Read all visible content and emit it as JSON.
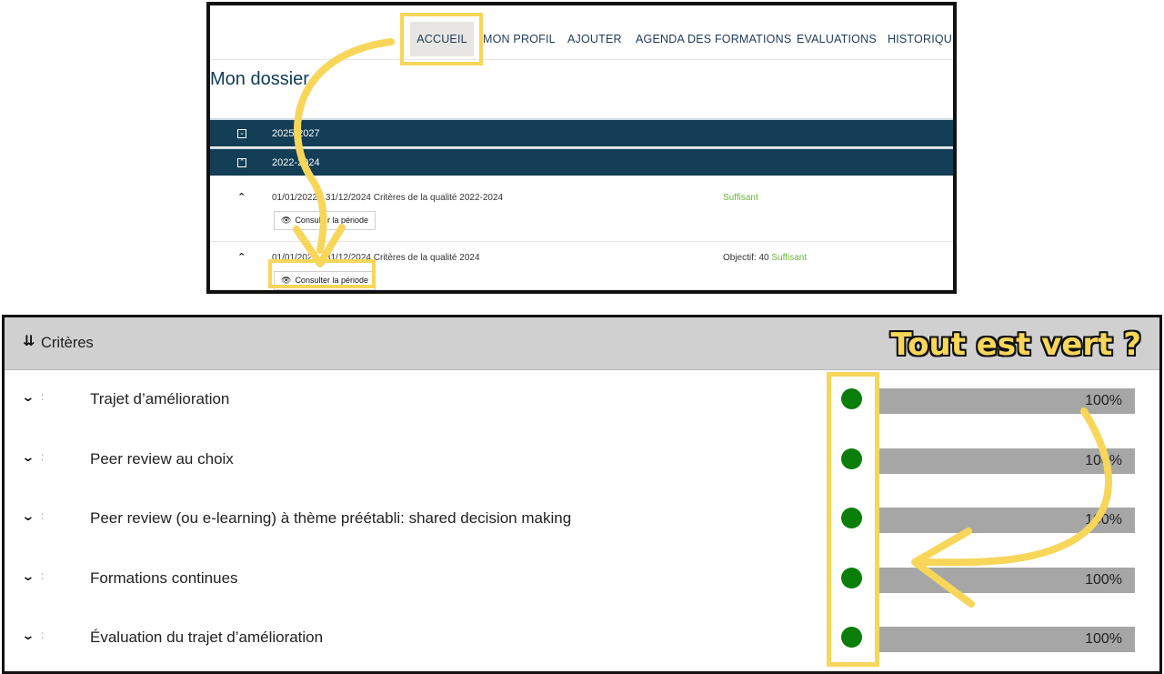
{
  "nav": {
    "items": [
      "ACCUEIL",
      "MON PROFIL",
      "AJOUTER",
      "AGENDA DES FORMATIONS",
      "EVALUATIONS",
      "HISTORIQUE"
    ]
  },
  "dossier": {
    "title": "Mon dossier",
    "years": [
      {
        "label": "2025-2027",
        "icon": "expand-down-icon"
      },
      {
        "label": "2022-2024",
        "icon": "collapse-up-icon"
      }
    ],
    "periods": [
      {
        "title": "01/01/2022 - 31/12/2024 Critères de la qualité 2022-2024",
        "objective": "",
        "status": "Suffisant",
        "button": "Consulter la période"
      },
      {
        "title": "01/01/2024 - 31/12/2024 Critères de la qualité 2024",
        "objective": "Objectif: 40",
        "status": "Suffisant",
        "button": "Consulter la période"
      }
    ]
  },
  "criteria": {
    "header": "Critères",
    "callout": "Tout est vert ?",
    "items": [
      {
        "label": "Trajet d’amélioration",
        "percent_label": "100%",
        "progress": 1.0,
        "status_color": "#0b7d0b"
      },
      {
        "label": "Peer review au choix",
        "percent_label": "100%",
        "progress": 1.0,
        "status_color": "#0b7d0b"
      },
      {
        "label": "Peer review (ou e-learning) à thème préétabli: shared decision making",
        "percent_label": "100%",
        "progress": 1.0,
        "status_color": "#0b7d0b"
      },
      {
        "label": "Formations continues",
        "percent_label": "100%",
        "progress": 1.0,
        "status_color": "#0b7d0b"
      },
      {
        "label": "Évaluation du trajet d’amélioration",
        "percent_label": "100%",
        "progress": 1.0,
        "status_color": "#0b7d0b"
      }
    ]
  },
  "colors": {
    "highlight": "#f7d65a",
    "header_bar": "#133e56",
    "status_green": "#0b7d0b",
    "ok_text": "#6db33f"
  }
}
